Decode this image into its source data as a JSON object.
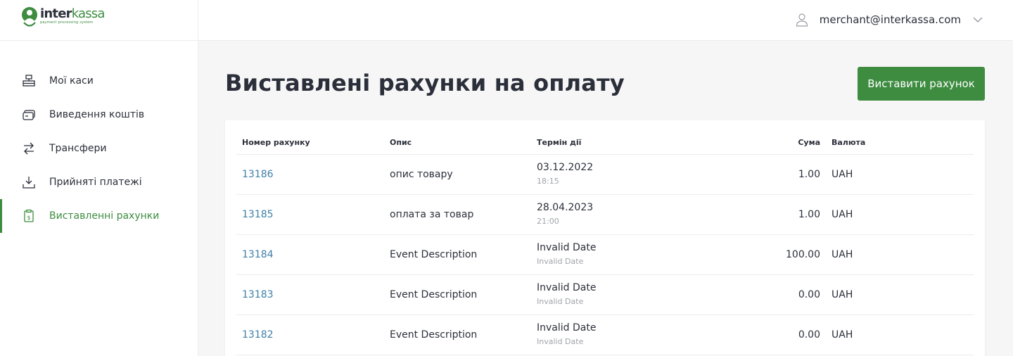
{
  "brand": {
    "name_part1": "inter",
    "name_part2": "kassa",
    "tagline": "payment processing system",
    "accent": "#3d8c40"
  },
  "header": {
    "user_email": "merchant@interkassa.com"
  },
  "sidebar": {
    "items": [
      {
        "label": "Мої каси",
        "icon": "cash-register-icon",
        "active": false
      },
      {
        "label": "Виведення коштів",
        "icon": "wallet-icon",
        "active": false
      },
      {
        "label": "Трансфери",
        "icon": "transfer-arrows-icon",
        "active": false
      },
      {
        "label": "Прийняті платежі",
        "icon": "download-icon",
        "active": false
      },
      {
        "label": "Виставленні рахунки",
        "icon": "invoice-icon",
        "active": true
      }
    ]
  },
  "main": {
    "title": "Виставлені рахунки на оплату",
    "create_button": "Виставити рахунок"
  },
  "table": {
    "columns": [
      "Номер рахунку",
      "Опис",
      "Термін дії",
      "Сума",
      "Валюта"
    ],
    "rows": [
      {
        "number": "13186",
        "description": "опис товару",
        "date": "03.12.2022",
        "time": "18:15",
        "amount": "1.00",
        "currency": "UAH"
      },
      {
        "number": "13185",
        "description": "оплата за товар",
        "date": "28.04.2023",
        "time": "21:00",
        "amount": "1.00",
        "currency": "UAH"
      },
      {
        "number": "13184",
        "description": "Event Description",
        "date": "Invalid Date",
        "time": "Invalid Date",
        "amount": "100.00",
        "currency": "UAH"
      },
      {
        "number": "13183",
        "description": "Event Description",
        "date": "Invalid Date",
        "time": "Invalid Date",
        "amount": "0.00",
        "currency": "UAH"
      },
      {
        "number": "13182",
        "description": "Event Description",
        "date": "Invalid Date",
        "time": "Invalid Date",
        "amount": "0.00",
        "currency": "UAH"
      }
    ]
  }
}
